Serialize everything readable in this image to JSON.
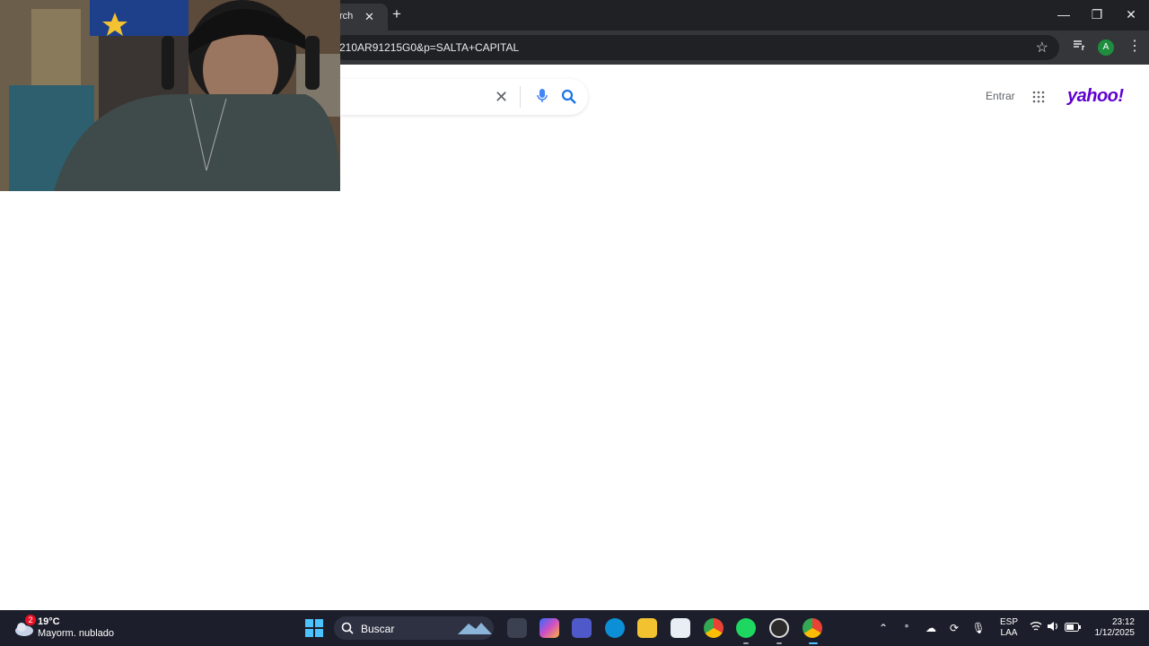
{
  "browser": {
    "tab_title": "rch",
    "tab_close_glyph": "✕",
    "new_tab_glyph": "+",
    "address_url": "210AR91215G0&p=SALTA+CAPITAL",
    "bookmark_icon": "star-icon",
    "window_minimize": "—",
    "window_restore": "❐",
    "window_close": "✕",
    "profile_initial": "A",
    "profile_color": "#1e8e3e"
  },
  "page": {
    "search_clear": "✕",
    "signin_label": "Entrar",
    "brand": "yahoo!",
    "brand_color": "#6001d2"
  },
  "taskbar": {
    "weather": {
      "temp": "19°C",
      "condition": "Mayorm. nublado",
      "badge": "2"
    },
    "search_label": "Buscar",
    "apps": [
      "task-view",
      "copilot",
      "teams",
      "edge",
      "file-explorer",
      "microsoft-store",
      "chrome",
      "spotify",
      "obs",
      "chrome-profile"
    ],
    "language": {
      "line1": "ESP",
      "line2": "LAA"
    },
    "clock": {
      "time": "23:12",
      "date": "1/12/2025"
    }
  }
}
